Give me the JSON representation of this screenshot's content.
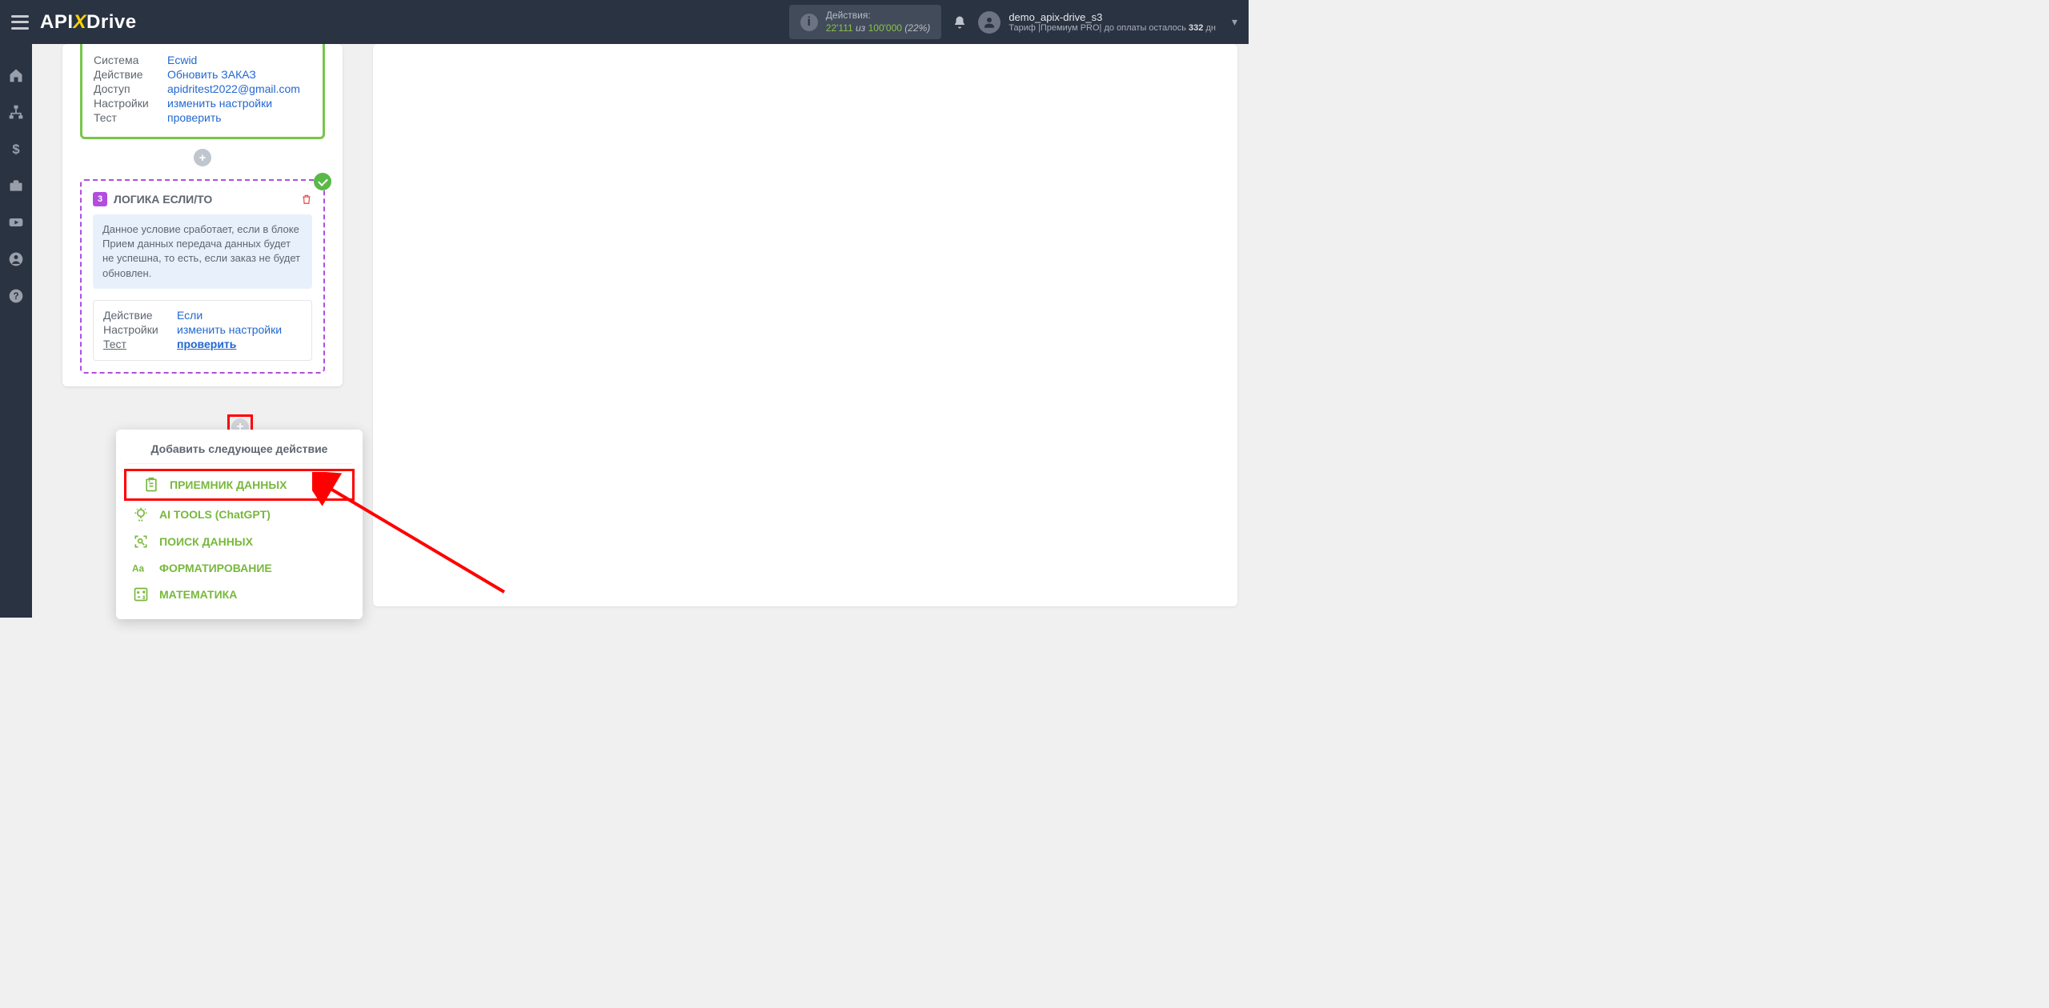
{
  "header": {
    "logo_a": "API",
    "logo_x": "X",
    "logo_b": "Drive",
    "actions_label": "Действия:",
    "actions_used": "22'111",
    "actions_sep": "из",
    "actions_total": "100'000",
    "actions_pct": "(22%)",
    "user_name": "demo_apix-drive_s3",
    "user_tariff_pre": "Тариф |Премиум PRO|  до оплаты осталось ",
    "user_tariff_days": "332",
    "user_tariff_suf": " дн"
  },
  "block_a": {
    "rows": [
      {
        "k": "Система",
        "v": "Ecwid"
      },
      {
        "k": "Действие",
        "v": "Обновить ЗАКАЗ"
      },
      {
        "k": "Доступ",
        "v": "apidritest2022@gmail.com"
      },
      {
        "k": "Настройки",
        "v": "изменить настройки"
      },
      {
        "k": "Тест",
        "v": "проверить"
      }
    ]
  },
  "block_b": {
    "num": "3",
    "title": "ЛОГИКА ЕСЛИ/ТО",
    "info": "Данное условие сработает, если в блоке Прием данных передача данных будет не успешна, то есть, если заказ не будет обновлен.",
    "rows": [
      {
        "k": "Действие",
        "v": "Если"
      },
      {
        "k": "Настройки",
        "v": "изменить настройки"
      },
      {
        "k": "Тест",
        "v": "проверить"
      }
    ]
  },
  "popup": {
    "title": "Добавить следующее действие",
    "items": [
      "ПРИЕМНИК ДАННЫХ",
      "AI TOOLS (ChatGPT)",
      "ПОИСК ДАННЫХ",
      "ФОРМАТИРОВАНИЕ",
      "МАТЕМАТИКА"
    ]
  }
}
